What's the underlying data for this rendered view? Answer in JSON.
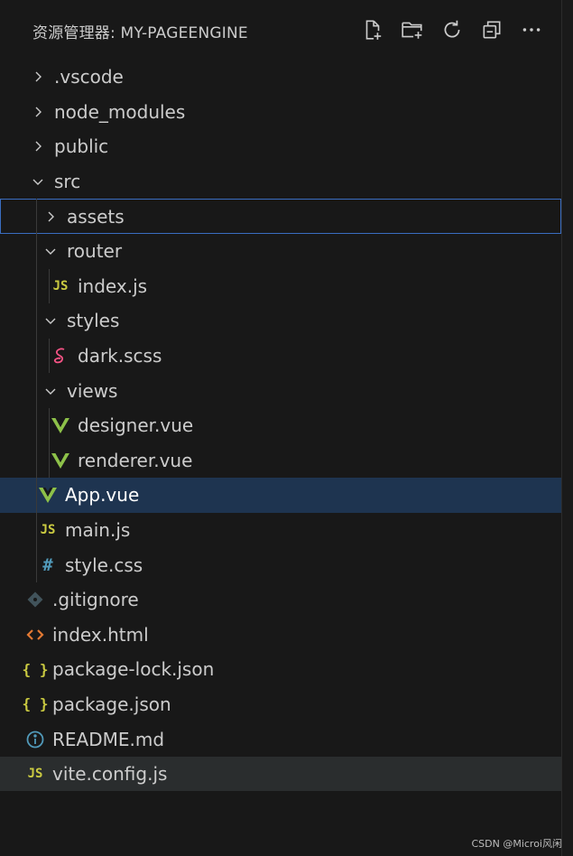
{
  "explorer": {
    "title": "资源管理器: MY-PAGEENGINE",
    "actions": [
      {
        "name": "new-file-icon"
      },
      {
        "name": "new-folder-icon"
      },
      {
        "name": "refresh-icon"
      },
      {
        "name": "collapse-all-icon"
      },
      {
        "name": "more-icon"
      }
    ]
  },
  "tree": [
    {
      "label": ".vscode",
      "type": "folder",
      "expanded": false,
      "depth": 0
    },
    {
      "label": "node_modules",
      "type": "folder",
      "expanded": false,
      "depth": 0
    },
    {
      "label": "public",
      "type": "folder",
      "expanded": false,
      "depth": 0
    },
    {
      "label": "src",
      "type": "folder",
      "expanded": true,
      "depth": 0
    },
    {
      "label": "assets",
      "type": "folder",
      "expanded": false,
      "depth": 1,
      "state": "focused"
    },
    {
      "label": "router",
      "type": "folder",
      "expanded": true,
      "depth": 1
    },
    {
      "label": "index.js",
      "type": "js",
      "depth": 2
    },
    {
      "label": "styles",
      "type": "folder",
      "expanded": true,
      "depth": 1
    },
    {
      "label": "dark.scss",
      "type": "scss",
      "depth": 2
    },
    {
      "label": "views",
      "type": "folder",
      "expanded": true,
      "depth": 1
    },
    {
      "label": "designer.vue",
      "type": "vue",
      "depth": 2
    },
    {
      "label": "renderer.vue",
      "type": "vue",
      "depth": 2
    },
    {
      "label": "App.vue",
      "type": "vue",
      "depth": 1,
      "state": "selected"
    },
    {
      "label": "main.js",
      "type": "js",
      "depth": 1
    },
    {
      "label": "style.css",
      "type": "css",
      "depth": 1
    },
    {
      "label": ".gitignore",
      "type": "git",
      "depth": 0
    },
    {
      "label": "index.html",
      "type": "html",
      "depth": 0
    },
    {
      "label": "package-lock.json",
      "type": "json",
      "depth": 0
    },
    {
      "label": "package.json",
      "type": "json",
      "depth": 0
    },
    {
      "label": "README.md",
      "type": "info",
      "depth": 0
    },
    {
      "label": "vite.config.js",
      "type": "js",
      "depth": 0,
      "state": "hover"
    }
  ],
  "icons": {
    "js": "js-file-icon",
    "vue": "vue-file-icon",
    "scss": "sass-file-icon",
    "css": "css-file-icon",
    "git": "git-file-icon",
    "html": "html-file-icon",
    "json": "json-file-icon",
    "info": "info-file-icon"
  },
  "colors": {
    "background": "#181818",
    "selected": "#1e3450",
    "focus_border": "#3a6dc0",
    "js": "#cbcb41",
    "vue": "#8dc149",
    "scss": "#f55385",
    "css": "#519aba",
    "git": "#41535b",
    "html": "#e37933",
    "json": "#cbcb41",
    "info": "#519aba"
  },
  "watermark": "CSDN @Microi风闲"
}
